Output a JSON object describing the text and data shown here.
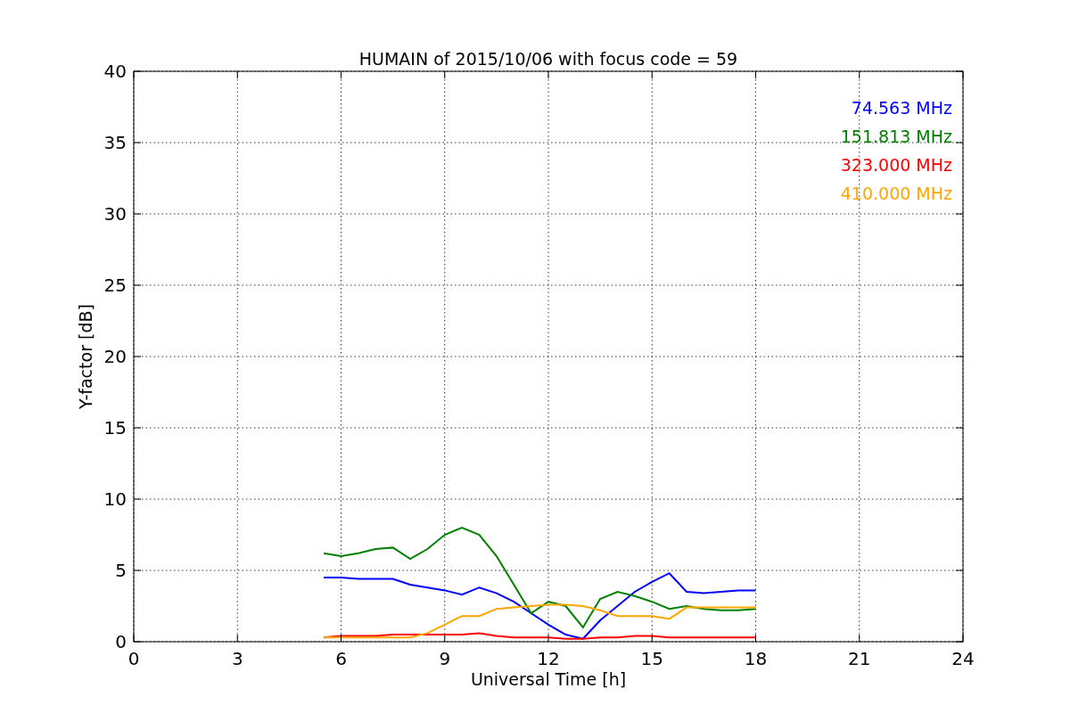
{
  "chart_data": {
    "type": "line",
    "title": "HUMAIN of 2015/10/06 with focus code = 59",
    "xlabel": "Universal Time [h]",
    "ylabel": "Y-factor [dB]",
    "x": [
      5.5,
      6,
      6.5,
      7,
      7.5,
      8,
      8.5,
      9,
      9.5,
      10,
      10.5,
      11,
      11.5,
      12,
      12.5,
      13,
      13.5,
      14,
      14.5,
      15,
      15.5,
      16,
      16.5,
      17,
      17.5,
      18
    ],
    "series": [
      {
        "name": "74.563 MHz",
        "color": "#0000ff",
        "values": [
          4.5,
          4.5,
          4.4,
          4.4,
          4.4,
          4.0,
          3.8,
          3.6,
          3.3,
          3.8,
          3.4,
          2.8,
          2.0,
          1.2,
          0.5,
          0.2,
          1.5,
          2.5,
          3.5,
          4.2,
          4.8,
          3.5,
          3.4,
          3.5,
          3.6,
          3.6
        ]
      },
      {
        "name": "151.813 MHz",
        "color": "#008000",
        "values": [
          6.2,
          6.0,
          6.2,
          6.5,
          6.6,
          5.8,
          6.5,
          7.5,
          8.0,
          7.5,
          6.0,
          4.0,
          2.0,
          2.8,
          2.5,
          1.0,
          3.0,
          3.5,
          3.2,
          2.8,
          2.3,
          2.5,
          2.3,
          2.2,
          2.2,
          2.3
        ]
      },
      {
        "name": "323.000 MHz",
        "color": "#ff0000",
        "values": [
          0.3,
          0.4,
          0.4,
          0.4,
          0.5,
          0.5,
          0.5,
          0.5,
          0.5,
          0.6,
          0.4,
          0.3,
          0.3,
          0.3,
          0.2,
          0.2,
          0.3,
          0.3,
          0.4,
          0.4,
          0.3,
          0.3,
          0.3,
          0.3,
          0.3,
          0.3
        ]
      },
      {
        "name": "410.000 MHz",
        "color": "#ffa500",
        "values": [
          0.3,
          0.3,
          0.3,
          0.3,
          0.3,
          0.3,
          0.6,
          1.2,
          1.8,
          1.8,
          2.3,
          2.4,
          2.5,
          2.6,
          2.6,
          2.5,
          2.2,
          1.8,
          1.8,
          1.8,
          1.6,
          2.4,
          2.4,
          2.4,
          2.4,
          2.4
        ]
      }
    ],
    "xlim": [
      0,
      24
    ],
    "ylim": [
      0,
      40
    ],
    "xticks": [
      0,
      3,
      6,
      9,
      12,
      15,
      18,
      21,
      24
    ],
    "yticks": [
      0,
      5,
      10,
      15,
      20,
      25,
      30,
      35,
      40
    ],
    "grid": true
  }
}
